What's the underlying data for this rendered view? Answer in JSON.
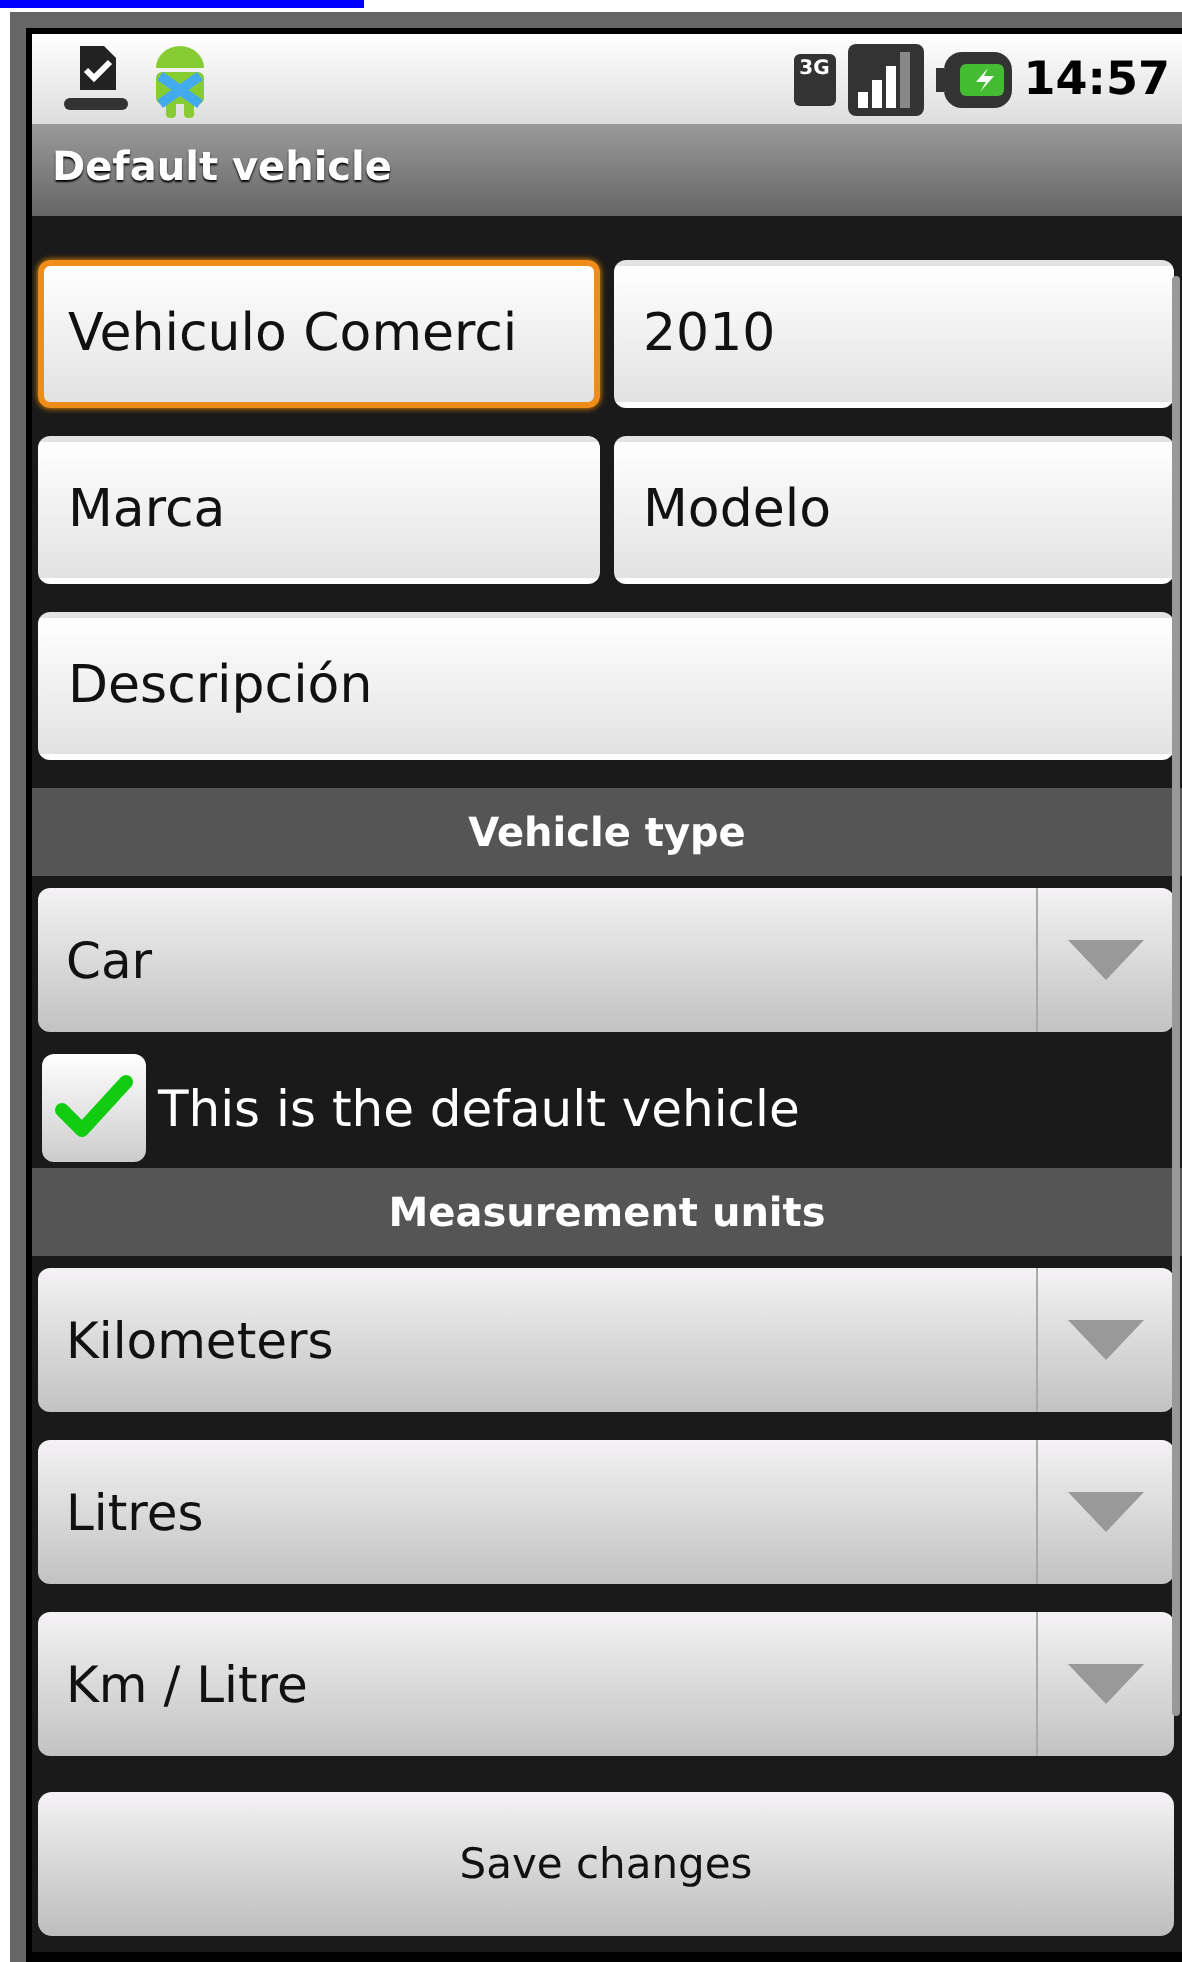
{
  "status_bar": {
    "time": "14:57",
    "network": "3G"
  },
  "title_bar": {
    "title": "Default vehicle"
  },
  "fields": [
    {
      "value": "Vehiculo Comerci",
      "focused": true
    },
    {
      "value": "2010",
      "focused": false
    },
    {
      "value": "Marca",
      "focused": false
    },
    {
      "value": "Modelo",
      "focused": false
    },
    {
      "value": "Descripción",
      "focused": false
    }
  ],
  "vehicle_type": {
    "header": "Vehicle type",
    "spinner": "Car"
  },
  "default_checkbox": {
    "label": "This is the default vehicle",
    "checked": true
  },
  "measurement_units": {
    "header": "Measurement units",
    "spinners": [
      "Kilometers",
      "Litres",
      "Km / Litre"
    ]
  },
  "save_button": {
    "label": "Save changes"
  }
}
